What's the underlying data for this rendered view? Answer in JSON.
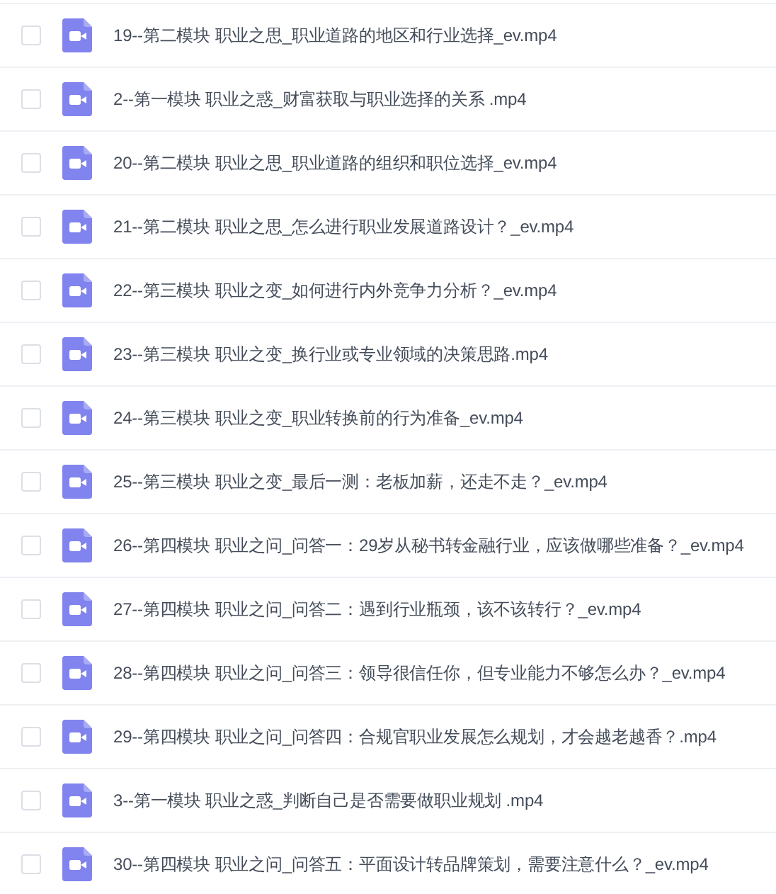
{
  "files": [
    {
      "name": "19--第二模块 职业之思_职业道路的地区和行业选择_ev.mp4",
      "checked": false
    },
    {
      "name": "2--第一模块 职业之惑_财富获取与职业选择的关系 .mp4",
      "checked": false
    },
    {
      "name": "20--第二模块 职业之思_职业道路的组织和职位选择_ev.mp4",
      "checked": false
    },
    {
      "name": "21--第二模块 职业之思_怎么进行职业发展道路设计？_ev.mp4",
      "checked": false
    },
    {
      "name": "22--第三模块 职业之变_如何进行内外竞争力分析？_ev.mp4",
      "checked": false
    },
    {
      "name": "23--第三模块 职业之变_换行业或专业领域的决策思路.mp4",
      "checked": false
    },
    {
      "name": "24--第三模块 职业之变_职业转换前的行为准备_ev.mp4",
      "checked": false
    },
    {
      "name": "25--第三模块 职业之变_最后一测：老板加薪，还走不走？_ev.mp4",
      "checked": false
    },
    {
      "name": "26--第四模块 职业之问_问答一：29岁从秘书转金融行业，应该做哪些准备？_ev.mp4",
      "checked": false
    },
    {
      "name": "27--第四模块 职业之问_问答二：遇到行业瓶颈，该不该转行？_ev.mp4",
      "checked": false
    },
    {
      "name": "28--第四模块 职业之问_问答三：领导很信任你，但专业能力不够怎么办？_ev.mp4",
      "checked": false
    },
    {
      "name": "29--第四模块 职业之问_问答四：合规官职业发展怎么规划，才会越老越香？.mp4",
      "checked": false
    },
    {
      "name": "3--第一模块 职业之惑_判断自己是否需要做职业规划 .mp4",
      "checked": false
    },
    {
      "name": "30--第四模块 职业之问_问答五：平面设计转品牌策划，需要注意什么？_ev.mp4",
      "checked": false
    }
  ]
}
